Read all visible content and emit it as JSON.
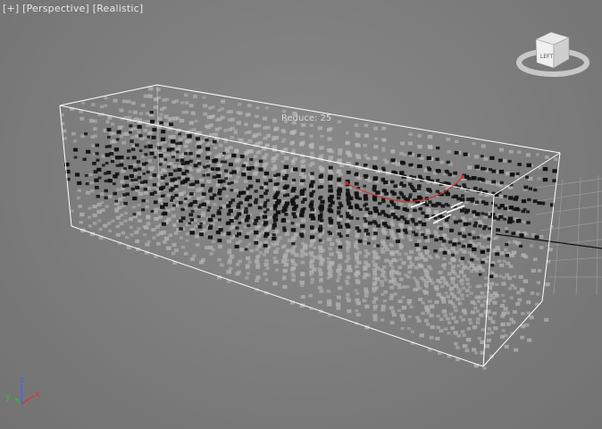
{
  "viewport": {
    "label_plus": "[+]",
    "label_view": "[Perspective]",
    "label_shading": "[Realistic]"
  },
  "overlay": {
    "reduce_text": "Reduce: 25"
  },
  "viewcube": {
    "face_label": "LEFT",
    "icon": "viewcube-icon"
  },
  "axis_gizmo": {
    "x_label": "x",
    "y_label": "y",
    "z_label": "z",
    "colors": {
      "x": "#e03030",
      "y": "#30c030",
      "z": "#4060ff"
    }
  },
  "colors": {
    "background": "#7b7b7b",
    "bounding_box": "#ffffff",
    "voxel_light": "#b8b8b8",
    "voxel_dark": "#111111",
    "spline": "#d03030"
  }
}
